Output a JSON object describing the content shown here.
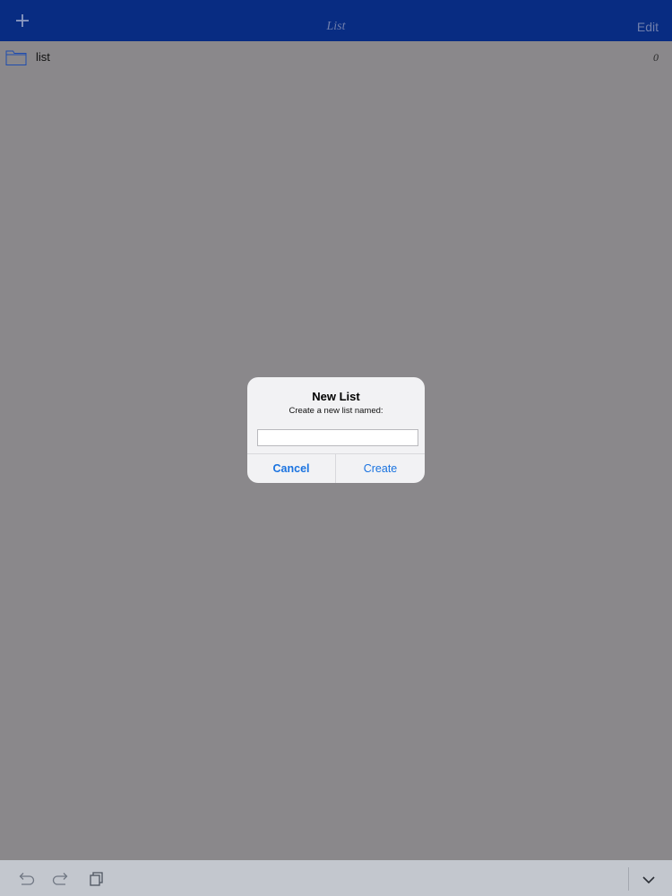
{
  "navbar": {
    "title": "List",
    "edit_label": "Edit",
    "add_icon": "plus-icon"
  },
  "list": {
    "items": [
      {
        "label": "list",
        "count": "0",
        "icon": "folder-icon"
      }
    ]
  },
  "dialog": {
    "title": "New List",
    "message": "Create a new list named:",
    "input_value": "",
    "cancel_label": "Cancel",
    "create_label": "Create"
  },
  "toolbar": {
    "icons": [
      "undo-icon",
      "redo-icon",
      "copy-icon",
      "chevron-down-icon"
    ]
  },
  "colors": {
    "navbar_bg": "#082c82",
    "overlay_bg": "#8a888b",
    "toolbar_bg": "#c3c7ce",
    "accent": "#1a73e0"
  }
}
